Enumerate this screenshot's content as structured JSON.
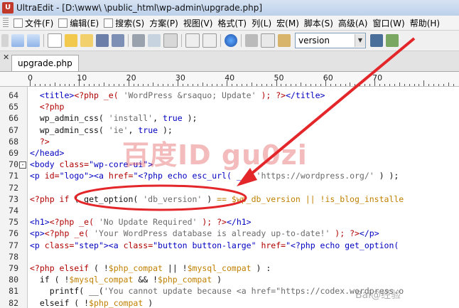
{
  "window": {
    "title": "UltraEdit - [D:\\www\\                   \\public_html\\wp-admin\\upgrade.php]"
  },
  "menu": [
    {
      "label": "文件(F)",
      "icon": "file-icon"
    },
    {
      "label": "编辑(E)",
      "icon": "edit-icon"
    },
    {
      "label": "搜索(S)",
      "icon": "search-icon"
    },
    {
      "label": "方案(P)"
    },
    {
      "label": "视图(V)"
    },
    {
      "label": "格式(T)"
    },
    {
      "label": "列(L)"
    },
    {
      "label": "宏(M)"
    },
    {
      "label": "脚本(S)"
    },
    {
      "label": "高级(A)"
    },
    {
      "label": "窗口(W)"
    },
    {
      "label": "帮助(H)"
    }
  ],
  "toolbar": {
    "search_value": "version",
    "icons": [
      "new-file-icon",
      "open-folder-icon",
      "save-icon",
      "save-all-icon",
      "print-icon",
      "print-preview-icon",
      "page-setup-icon",
      "word-wrap-icon",
      "spell-check-icon",
      "browser-icon",
      "cut-icon",
      "copy-icon",
      "paste-icon"
    ],
    "find_icon": "binoculars-icon"
  },
  "tabs": [
    {
      "label": "upgrade.php",
      "active": true
    }
  ],
  "ruler": {
    "labels": [
      "0",
      "10",
      "20",
      "30",
      "40",
      "50",
      "60",
      "70"
    ]
  },
  "lines": [
    {
      "num": "64",
      "segments": [
        {
          "t": "  ",
          "c": "t-txt"
        },
        {
          "t": "<title>",
          "c": "t-kw"
        },
        {
          "t": "<?php _e( ",
          "c": "t-php"
        },
        {
          "t": "'WordPress &rsaquo; Update'",
          "c": "t-str"
        },
        {
          "t": " ); ?>",
          "c": "t-php"
        },
        {
          "t": "</title>",
          "c": "t-kw"
        }
      ]
    },
    {
      "num": "65",
      "segments": [
        {
          "t": "  ",
          "c": "t-txt"
        },
        {
          "t": "<?php",
          "c": "t-php"
        }
      ]
    },
    {
      "num": "66",
      "segments": [
        {
          "t": "  wp_admin_css( ",
          "c": "t-txt"
        },
        {
          "t": "'install'",
          "c": "t-str"
        },
        {
          "t": ", ",
          "c": "t-txt"
        },
        {
          "t": "true",
          "c": "t-kw"
        },
        {
          "t": " );",
          "c": "t-txt"
        }
      ]
    },
    {
      "num": "67",
      "segments": [
        {
          "t": "  wp_admin_css( ",
          "c": "t-txt"
        },
        {
          "t": "'ie'",
          "c": "t-str"
        },
        {
          "t": ", ",
          "c": "t-txt"
        },
        {
          "t": "true",
          "c": "t-kw"
        },
        {
          "t": " );",
          "c": "t-txt"
        }
      ]
    },
    {
      "num": "68",
      "segments": [
        {
          "t": "  ?>",
          "c": "t-php"
        }
      ]
    },
    {
      "num": "69",
      "segments": [
        {
          "t": "</head>",
          "c": "t-kw"
        }
      ]
    },
    {
      "num": "70",
      "fold": "-",
      "segments": [
        {
          "t": "<body ",
          "c": "t-kw"
        },
        {
          "t": "class=",
          "c": "t-php"
        },
        {
          "t": "\"wp-core-ui\"",
          "c": "t-kw"
        },
        {
          "t": ">",
          "c": "t-kw"
        }
      ]
    },
    {
      "num": "71",
      "segments": [
        {
          "t": "<p ",
          "c": "t-kw"
        },
        {
          "t": "id=",
          "c": "t-php"
        },
        {
          "t": "\"logo\"",
          "c": "t-kw"
        },
        {
          "t": "><a ",
          "c": "t-kw"
        },
        {
          "t": "href=",
          "c": "t-php"
        },
        {
          "t": "\"<?php echo esc_url( __( ",
          "c": "t-kw"
        },
        {
          "t": "'https://wordpress.org/'",
          "c": "t-str"
        },
        {
          "t": " ) );",
          "c": "t-txt"
        }
      ]
    },
    {
      "num": "72",
      "segments": []
    },
    {
      "num": "73",
      "segments": [
        {
          "t": "<?php if ",
          "c": "t-php"
        },
        {
          "t": "( get_option( ",
          "c": "t-txt"
        },
        {
          "t": "'db_version'",
          "c": "t-str"
        },
        {
          "t": " ) ",
          "c": "t-txt"
        },
        {
          "t": "== $wp_db_version || !is_blog_installe",
          "c": "t-var"
        }
      ]
    },
    {
      "num": "74",
      "segments": []
    },
    {
      "num": "75",
      "segments": [
        {
          "t": "<h1>",
          "c": "t-kw"
        },
        {
          "t": "<?php _e( ",
          "c": "t-php"
        },
        {
          "t": "'No Update Required'",
          "c": "t-str"
        },
        {
          "t": " ); ?>",
          "c": "t-php"
        },
        {
          "t": "</h1>",
          "c": "t-kw"
        }
      ]
    },
    {
      "num": "76",
      "segments": [
        {
          "t": "<p>",
          "c": "t-kw"
        },
        {
          "t": "<?php _e( ",
          "c": "t-php"
        },
        {
          "t": "'Your WordPress database is already up-to-date!'",
          "c": "t-str"
        },
        {
          "t": " ); ?>",
          "c": "t-php"
        },
        {
          "t": "</p>",
          "c": "t-kw"
        }
      ]
    },
    {
      "num": "77",
      "segments": [
        {
          "t": "<p ",
          "c": "t-kw"
        },
        {
          "t": "class=",
          "c": "t-php"
        },
        {
          "t": "\"step\"",
          "c": "t-kw"
        },
        {
          "t": "><a ",
          "c": "t-kw"
        },
        {
          "t": "class=",
          "c": "t-php"
        },
        {
          "t": "\"button button-large\" ",
          "c": "t-kw"
        },
        {
          "t": "href=",
          "c": "t-php"
        },
        {
          "t": "\"<?php echo get_option(",
          "c": "t-kw"
        }
      ]
    },
    {
      "num": "78",
      "segments": []
    },
    {
      "num": "79",
      "segments": [
        {
          "t": "<?php elseif ",
          "c": "t-php"
        },
        {
          "t": "( !",
          "c": "t-txt"
        },
        {
          "t": "$php_compat",
          "c": "t-var"
        },
        {
          "t": " || !",
          "c": "t-txt"
        },
        {
          "t": "$mysql_compat",
          "c": "t-var"
        },
        {
          "t": " ) :",
          "c": "t-txt"
        }
      ]
    },
    {
      "num": "80",
      "segments": [
        {
          "t": "  if ( !",
          "c": "t-txt"
        },
        {
          "t": "$mysql_compat",
          "c": "t-var"
        },
        {
          "t": " && !",
          "c": "t-txt"
        },
        {
          "t": "$php_compat",
          "c": "t-var"
        },
        {
          "t": " )",
          "c": "t-txt"
        }
      ]
    },
    {
      "num": "81",
      "segments": [
        {
          "t": "    printf( __(",
          "c": "t-txt"
        },
        {
          "t": "'You cannot update because <a href=\"https://codex.wordpress.o",
          "c": "t-str"
        }
      ]
    },
    {
      "num": "82",
      "segments": [
        {
          "t": "  elseif ( !",
          "c": "t-txt"
        },
        {
          "t": "$php_compat",
          "c": "t-var"
        },
        {
          "t": " )",
          "c": "t-txt"
        }
      ]
    }
  ],
  "watermark": {
    "text": "百度ID gu0zi",
    "footer": "Bai@经验"
  }
}
